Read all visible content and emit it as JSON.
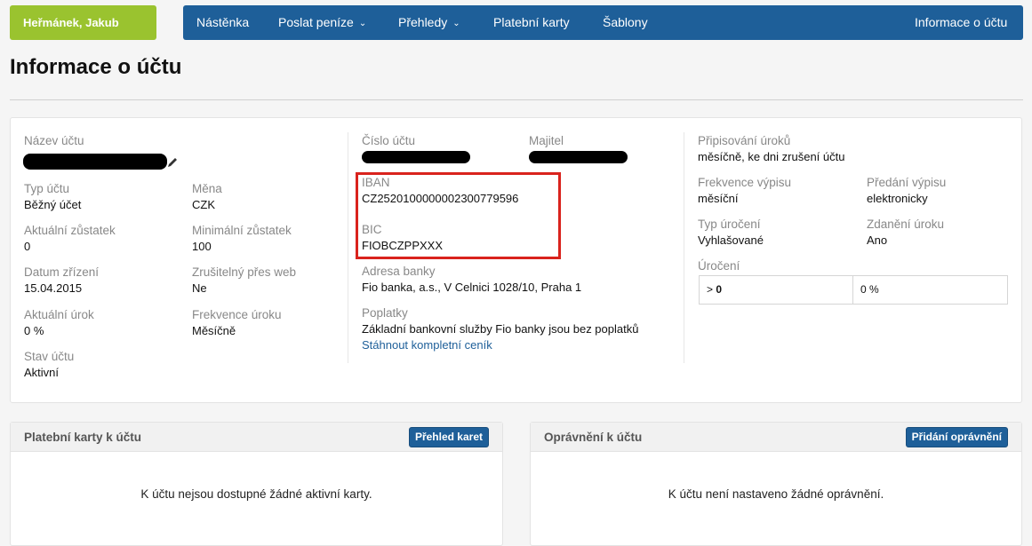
{
  "header": {
    "user_name": "Heřmánek, Jakub",
    "nav": [
      {
        "label": "Nástěnka"
      },
      {
        "label": "Poslat peníze"
      },
      {
        "label": "Přehledy"
      },
      {
        "label": "Platební karty"
      },
      {
        "label": "Šablony"
      },
      {
        "label": "Informace o účtu"
      }
    ]
  },
  "page_title": "Informace o účtu",
  "account": {
    "name_label": "Název účtu",
    "type_label": "Typ účtu",
    "type_value": "Běžný účet",
    "currency_label": "Měna",
    "currency_value": "CZK",
    "balance_label": "Aktuální zůstatek",
    "balance_value": "0",
    "min_balance_label": "Minimální zůstatek",
    "min_balance_value": "100",
    "created_label": "Datum zřízení",
    "created_value": "15.04.2015",
    "web_cancel_label": "Zrušitelný přes web",
    "web_cancel_value": "Ne",
    "rate_label": "Aktuální úrok",
    "rate_value": "0 %",
    "rate_freq_label": "Frekvence úroku",
    "rate_freq_value": "Měsíčně",
    "state_label": "Stav účtu",
    "state_value": "Aktivní",
    "number_label": "Číslo účtu",
    "owner_label": "Majitel",
    "iban_label": "IBAN",
    "iban_value": "CZ2520100000002300779596",
    "bic_label": "BIC",
    "bic_value": "FIOBCZPPXXX",
    "bank_address_label": "Adresa banky",
    "bank_address_value": "Fio banka, a.s., V Celnici 1028/10, Praha 1",
    "fees_label": "Poplatky",
    "fees_value": "Základní bankovní služby Fio banky jsou bez poplatků",
    "fees_link": "Stáhnout kompletní ceník",
    "interest_credit_label": "Připisování úroků",
    "interest_credit_value": "měsíčně, ke dni zrušení účtu",
    "statement_freq_label": "Frekvence výpisu",
    "statement_freq_value": "měsíční",
    "statement_delivery_label": "Předání výpisu",
    "statement_delivery_value": "elektronicky",
    "interest_type_label": "Typ úročení",
    "interest_type_value": "Vyhlašované",
    "interest_tax_label": "Zdanění úroku",
    "interest_tax_value": "Ano",
    "interest_label": "Úročení",
    "interest_table": {
      "threshold_prefix": "> ",
      "threshold": "0",
      "rate": "0 %"
    }
  },
  "cards_panel": {
    "title": "Platební karty k účtu",
    "button": "Přehled karet",
    "message": "K účtu nejsou dostupné žádné aktivní karty."
  },
  "permissions_panel": {
    "title": "Oprávnění k účtu",
    "button": "Přidání oprávnění",
    "message": "K účtu není nastaveno žádné oprávnění."
  },
  "colors": {
    "nav": "#1e5f99",
    "user": "#9ac32f",
    "highlight": "#d9231d"
  }
}
